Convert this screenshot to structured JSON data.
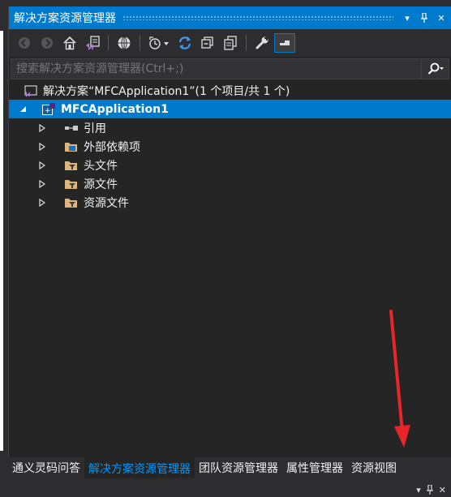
{
  "panel": {
    "title": "解决方案资源管理器",
    "title_buttons": [
      "▾",
      "⊣",
      "✕"
    ]
  },
  "toolbar": {
    "icons": [
      "back-icon",
      "forward-icon",
      "home-icon",
      "switch-views-icon",
      "web-icon",
      "pending-changes-icon",
      "refresh-icon",
      "collapse-all-icon",
      "show-all-files-icon",
      "properties-icon",
      "preview-icon"
    ]
  },
  "search": {
    "placeholder": "搜索解决方案资源管理器(Ctrl+;)"
  },
  "tree": {
    "solution": "解决方案“MFCApplication1”(1 个项目/共 1 个)",
    "project": "MFCApplication1",
    "children": [
      "引用",
      "外部依赖项",
      "头文件",
      "源文件",
      "资源文件"
    ]
  },
  "tabs": [
    "通义灵码问答",
    "解决方案资源管理器",
    "团队资源管理器",
    "属性管理器",
    "资源视图"
  ],
  "active_tab": "解决方案资源管理器",
  "colors": {
    "accent": "#007acc",
    "background": "#252526",
    "annotation_arrow": "#e8262a"
  }
}
